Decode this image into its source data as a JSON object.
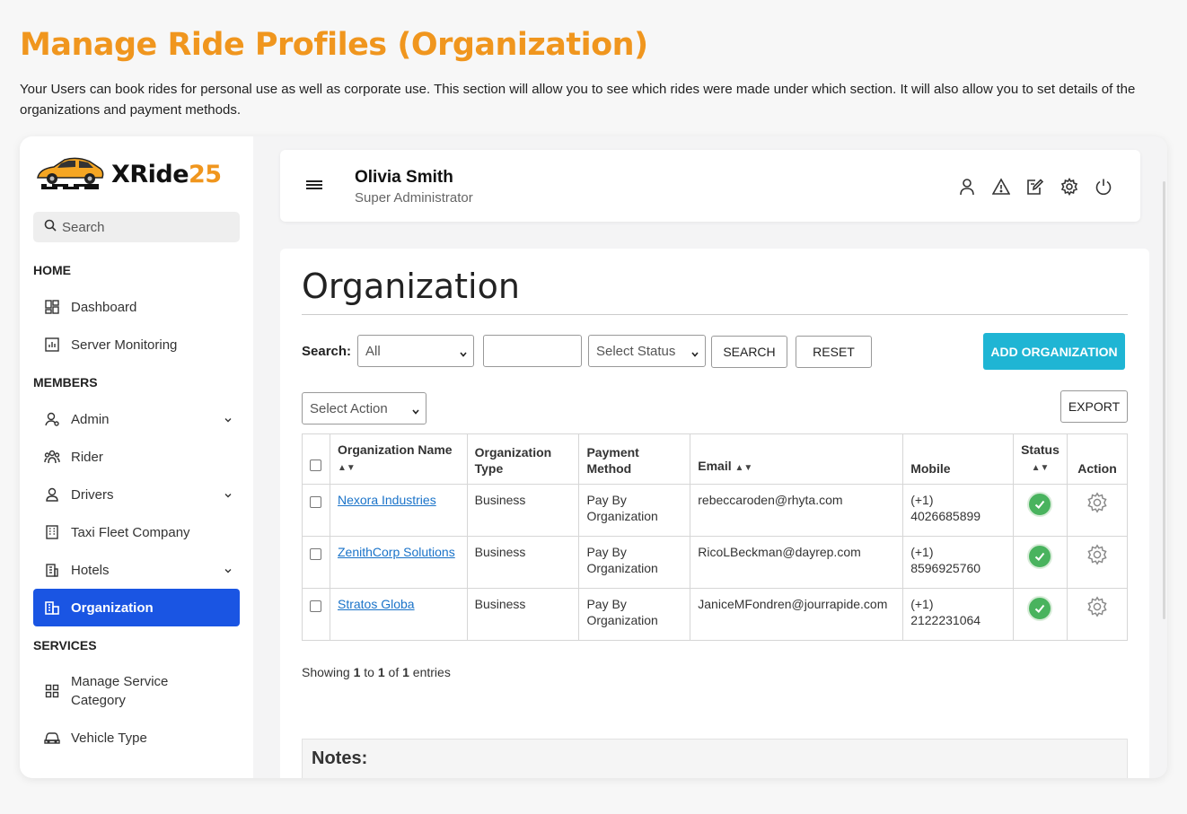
{
  "page": {
    "heading": "Manage Ride Profiles (Organization)",
    "intro": "Your Users can book rides for personal use as well as corporate use. This section will allow you to see which rides were made under which section. It will also allow you to set details of the organizations and payment methods."
  },
  "brand": {
    "name_dark": "XRide",
    "name_accent": "25"
  },
  "sidebar": {
    "search_placeholder": "Search",
    "sections": {
      "home": "HOME",
      "members": "MEMBERS",
      "services": "SERVICES"
    },
    "items": {
      "dashboard": "Dashboard",
      "server_monitoring": "Server Monitoring",
      "admin": "Admin",
      "rider": "Rider",
      "drivers": "Drivers",
      "taxi_fleet": "Taxi Fleet Company",
      "hotels": "Hotels",
      "organization": "Organization",
      "manage_service_1": "Manage Service",
      "manage_service_2": "Category",
      "vehicle_type": "Vehicle Type"
    }
  },
  "header": {
    "user_name": "Olivia Smith",
    "user_role": "Super Administrator"
  },
  "main": {
    "title": "Organization",
    "search_label": "Search:",
    "filter_select": "All",
    "status_select": "Select Status",
    "search_button": "SEARCH",
    "reset_button": "RESET",
    "add_button": "ADD ORGANIZATION",
    "action_select": "Select Action",
    "export_button": "EXPORT",
    "columns": {
      "name": "Organization Name",
      "type_1": "Organization",
      "type_2": "Type",
      "payment_1": "Payment",
      "payment_2": "Method",
      "email": "Email",
      "mobile": "Mobile",
      "status": "Status",
      "action": "Action"
    },
    "rows": [
      {
        "name": "Nexora Industries",
        "type": "Business",
        "payment_1": "Pay By",
        "payment_2": "Organization",
        "email": "rebeccaroden@rhyta.com",
        "mobile_1": "(+1)",
        "mobile_2": "4026685899"
      },
      {
        "name": "ZenithCorp Solutions",
        "type": "Business",
        "payment_1": "Pay By",
        "payment_2": "Organization",
        "email": "RicoLBeckman@dayrep.com",
        "mobile_1": "(+1)",
        "mobile_2": "8596925760"
      },
      {
        "name": "Stratos Globa",
        "type": "Business",
        "payment_1": "Pay By",
        "payment_2": "Organization",
        "email": "JaniceMFondren@jourrapide.com",
        "mobile_1": "(+1) 2122231064",
        "mobile_2": ""
      }
    ],
    "showing": {
      "prefix": "Showing ",
      "from": "1",
      "to_word": " to ",
      "to": "1",
      "of_word": " of ",
      "total": "1",
      "suffix": " entries"
    },
    "notes_title": "Notes:"
  },
  "colors": {
    "accent": "#f0961e",
    "primary": "#1a55e3",
    "cyan": "#1fb5d4",
    "status_ok": "#49b35e",
    "link": "#1a73c9"
  },
  "icons": [
    "search-icon",
    "dashboard-icon",
    "monitor-icon",
    "admin-icon",
    "rider-icon",
    "driver-icon",
    "building-icon",
    "hotel-icon",
    "organization-icon",
    "grid-icon",
    "car-icon",
    "hamburger-icon",
    "user-icon",
    "alert-icon",
    "edit-icon",
    "gear-icon",
    "power-icon",
    "chevron-down-icon",
    "check-icon"
  ]
}
